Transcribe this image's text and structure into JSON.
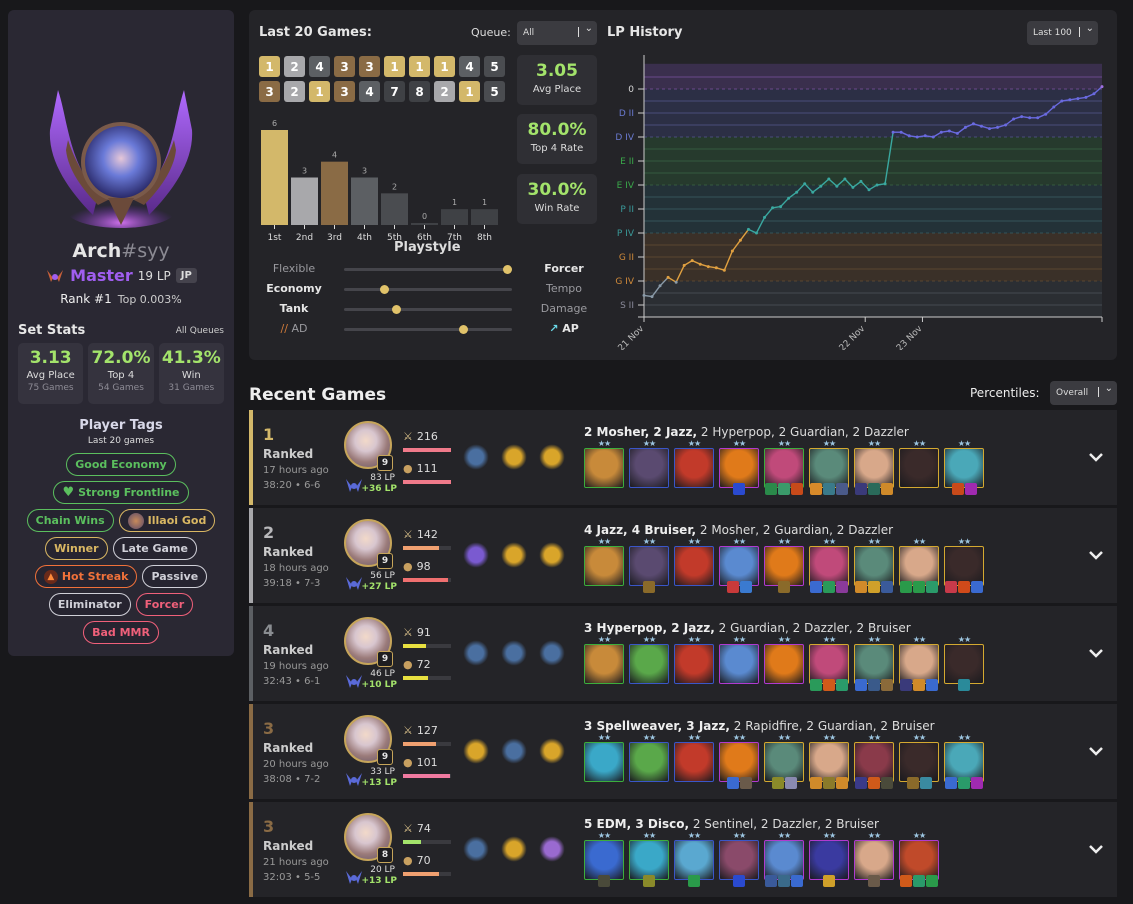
{
  "profile": {
    "name": "Arch",
    "tag": "#syy",
    "tier": "Master",
    "lp": "19 LP",
    "region": "JP",
    "rank": "Rank #1",
    "top": "Top 0.003%",
    "set_stats_title": "Set Stats",
    "set_stats_queue": "All Queues",
    "stats": [
      {
        "value": "3.13",
        "label": "Avg Place",
        "sub": "75 Games"
      },
      {
        "value": "72.0%",
        "label": "Top 4",
        "sub": "54 Games"
      },
      {
        "value": "41.3%",
        "label": "Win",
        "sub": "31 Games"
      }
    ],
    "tags_title": "Player Tags",
    "tags_subtitle": "Last 20 games",
    "tags": [
      {
        "label": "Good Economy",
        "color": "#5bbf5e",
        "icon": ""
      },
      {
        "label": "Strong Frontline",
        "color": "#5bbf5e",
        "icon": "heart-icon"
      },
      {
        "label": "Chain Wins",
        "color": "#5bbf5e",
        "icon": ""
      },
      {
        "label": "Illaoi God",
        "color": "#d9b763",
        "icon": "champion-icon"
      },
      {
        "label": "Winner",
        "color": "#d9b763",
        "icon": ""
      },
      {
        "label": "Late Game",
        "color": "#d0d0d8",
        "icon": ""
      },
      {
        "label": "Hot Streak",
        "color": "#f0713a",
        "icon": "fire-icon"
      },
      {
        "label": "Passive",
        "color": "#d0d0d8",
        "icon": ""
      },
      {
        "label": "Eliminator",
        "color": "#d0d0d8",
        "icon": ""
      },
      {
        "label": "Forcer",
        "color": "#f0607a",
        "icon": ""
      },
      {
        "label": "Bad MMR",
        "color": "#f0607a",
        "icon": ""
      }
    ]
  },
  "last20": {
    "title": "Last 20 Games:",
    "queue_label": "Queue:",
    "queue_value": "All",
    "placements": [
      1,
      2,
      4,
      3,
      3,
      1,
      1,
      1,
      4,
      5,
      3,
      2,
      1,
      3,
      4,
      7,
      8,
      2,
      1,
      5
    ],
    "avg_place": {
      "value": "3.05",
      "label": "Avg Place"
    },
    "top4_rate": {
      "value": "80.0%",
      "label": "Top 4 Rate"
    },
    "win_rate": {
      "value": "30.0%",
      "label": "Win Rate"
    },
    "place_colors": {
      "1": "#d3b86a",
      "2": "#a8a8ab",
      "3": "#8a6b45",
      "4": "#5c5f63",
      "5": "#4a4c50",
      "6": "#3f4145",
      "7": "#3f4145",
      "8": "#3f4145"
    }
  },
  "chart_data": [
    {
      "type": "bar",
      "title": "Placement distribution",
      "categories": [
        "1st",
        "2nd",
        "3rd",
        "4th",
        "5th",
        "6th",
        "7th",
        "8th"
      ],
      "values": [
        6,
        3,
        4,
        3,
        2,
        0,
        1,
        1
      ],
      "ylim": [
        0,
        6
      ]
    },
    {
      "type": "line",
      "title": "LP History",
      "range_label": "Last 100",
      "y_tick_labels": [
        "0",
        "D II",
        "D IV",
        "E II",
        "E IV",
        "P II",
        "P IV",
        "G II",
        "G IV",
        "S II"
      ],
      "x_tick_labels": [
        "21 Nov",
        "22 Nov",
        "23 Nov"
      ],
      "y_units": "ladder steps (0 = Master 0 LP, each tick = 1 division step, S II = 9)",
      "values": [
        8.6,
        8.65,
        8.2,
        7.85,
        8.05,
        7.35,
        7.15,
        7.3,
        7.4,
        7.45,
        7.55,
        6.75,
        6.3,
        5.85,
        6.0,
        5.35,
        4.95,
        4.9,
        4.55,
        4.3,
        3.95,
        4.3,
        4.05,
        3.75,
        4.05,
        3.75,
        4.1,
        3.85,
        4.2,
        4.0,
        3.95,
        1.8,
        1.8,
        1.95,
        2.0,
        1.95,
        2.0,
        1.8,
        1.75,
        1.85,
        1.6,
        1.45,
        1.55,
        1.65,
        1.6,
        1.5,
        1.25,
        1.15,
        1.2,
        1.2,
        1.05,
        0.75,
        0.5,
        0.45,
        0.4,
        0.35,
        0.2,
        -0.1
      ],
      "bands": [
        {
          "name": "Master",
          "color": "#3a2f4d"
        },
        {
          "name": "Diamond",
          "color": "#2c2f45"
        },
        {
          "name": "Emerald",
          "color": "#263a2d"
        },
        {
          "name": "Platinum",
          "color": "#233238"
        },
        {
          "name": "Gold",
          "color": "#3a3028"
        },
        {
          "name": "Silver",
          "color": "#2b2e33"
        }
      ]
    }
  ],
  "playstyle": {
    "title": "Playstyle",
    "rows": [
      {
        "left": "Flexible",
        "right": "Forcer",
        "value": 0.97,
        "left_bold": false,
        "right_bold": true
      },
      {
        "left": "Economy",
        "right": "Tempo",
        "value": 0.24,
        "left_bold": true,
        "right_bold": false
      },
      {
        "left": "Tank",
        "right": "Damage",
        "value": 0.31,
        "left_bold": true,
        "right_bold": false
      },
      {
        "left": "AD",
        "right": "AP",
        "value": 0.71,
        "left_bold": false,
        "right_bold": true
      }
    ]
  },
  "recent": {
    "title": "Recent Games",
    "percentiles_label": "Percentiles:",
    "percentiles_value": "Overall",
    "games": [
      {
        "place": "1",
        "queue": "Ranked",
        "ago": "17 hours ago",
        "duration": "38:20 • 6-6",
        "level": "9",
        "lp": "83 LP",
        "lp_delta": "+36 LP",
        "damage": "216",
        "damage_pct": 1.0,
        "damage_color": "#f07a8a",
        "gold": "111",
        "gold_pct": 1.0,
        "gold_color": "#f07a8a",
        "border": "#d3b86a",
        "place_color": "#d3b86a",
        "augments": [
          "#4a6fa0",
          "#d9a52a",
          "#d9a52a"
        ],
        "traits_main": "2 Mosher, 2 Jazz,",
        "traits_rest": "2 Hyperpop, 2 Guardian, 2 Dazzler",
        "units": [
          {
            "b": "#3cae3c",
            "c": "#c88a3a",
            "items": []
          },
          {
            "b": "#3a56c8",
            "c": "#5a4a70",
            "items": []
          },
          {
            "b": "#3a56c8",
            "c": "#c23a2a",
            "items": []
          },
          {
            "b": "#b03ad0",
            "c": "#e07a1a",
            "items": [
              "#2a4ad0"
            ]
          },
          {
            "b": "#3cae3c",
            "c": "#c04a7a",
            "items": [
              "#2a8a4a",
              "#3a9a6a",
              "#c84a1a"
            ]
          },
          {
            "b": "#d4a930",
            "c": "#5a8a7a",
            "items": [
              "#d88a2a",
              "#3a7a8a",
              "#4a5a8a"
            ]
          },
          {
            "b": "#d4a930",
            "c": "#d8a88a",
            "items": [
              "#3a3a7a",
              "#2a6a5a",
              "#d08a2a"
            ]
          },
          {
            "b": "#d4a930",
            "c": "#3a2a2a",
            "items": []
          },
          {
            "b": "#d4a930",
            "c": "#4aa8b8",
            "items": [
              "#c84a1a",
              "#a02ab0"
            ]
          }
        ]
      },
      {
        "place": "2",
        "queue": "Ranked",
        "ago": "18 hours ago",
        "duration": "39:18 • 7-3",
        "level": "9",
        "lp": "56 LP",
        "lp_delta": "+27 LP",
        "damage": "142",
        "damage_pct": 0.75,
        "damage_color": "#f0a070",
        "gold": "98",
        "gold_pct": 0.93,
        "gold_color": "#f07070",
        "border": "#a8a8ab",
        "place_color": "#b8b8bb",
        "augments": [
          "#7a5ad0",
          "#d9a52a",
          "#d9a52a"
        ],
        "traits_main": "4 Jazz, 4 Bruiser,",
        "traits_rest": "2 Mosher, 2 Guardian, 2 Dazzler",
        "units": [
          {
            "b": "#3cae3c",
            "c": "#c88a3a",
            "items": []
          },
          {
            "b": "#3a56c8",
            "c": "#5a4a70",
            "items": [
              "#8a6a2a"
            ]
          },
          {
            "b": "#3a56c8",
            "c": "#c23a2a",
            "items": []
          },
          {
            "b": "#b03ad0",
            "c": "#5a8ad0",
            "items": [
              "#c83a3a",
              "#3a7ad0"
            ]
          },
          {
            "b": "#b03ad0",
            "c": "#e07a1a",
            "items": [
              "#8a6a2a"
            ]
          },
          {
            "b": "#d4a930",
            "c": "#c04a7a",
            "items": [
              "#3a6ad0",
              "#2a9a5a",
              "#8a3a9a"
            ]
          },
          {
            "b": "#d4a930",
            "c": "#5a8a7a",
            "items": [
              "#d08a2a",
              "#d0a02a",
              "#3a5a9a"
            ]
          },
          {
            "b": "#d4a930",
            "c": "#d8a88a",
            "items": [
              "#2a9a4a",
              "#2a9a4a",
              "#2a9a6a"
            ]
          },
          {
            "b": "#d4a930",
            "c": "#3a2a2a",
            "items": [
              "#c83a4a",
              "#d04a1a",
              "#3a6ad0"
            ]
          }
        ]
      },
      {
        "place": "4",
        "queue": "Ranked",
        "ago": "19 hours ago",
        "duration": "32:43 • 6-1",
        "level": "9",
        "lp": "46 LP",
        "lp_delta": "+10 LP",
        "damage": "91",
        "damage_pct": 0.48,
        "damage_color": "#e8e040",
        "gold": "72",
        "gold_pct": 0.52,
        "gold_color": "#e8e040",
        "border": "#5c5f63",
        "place_color": "#8a8d91",
        "augments": [
          "#4a6fa0",
          "#4a6fa0",
          "#4a6fa0"
        ],
        "traits_main": "3 Hyperpop, 2 Jazz,",
        "traits_rest": "2 Guardian, 2 Dazzler, 2 Bruiser",
        "units": [
          {
            "b": "#3cae3c",
            "c": "#c88a3a",
            "items": []
          },
          {
            "b": "#3a56c8",
            "c": "#5aa84a",
            "items": []
          },
          {
            "b": "#3a56c8",
            "c": "#c23a2a",
            "items": []
          },
          {
            "b": "#b03ad0",
            "c": "#5a8ad0",
            "items": []
          },
          {
            "b": "#b03ad0",
            "c": "#e07a1a",
            "items": []
          },
          {
            "b": "#d4a930",
            "c": "#c04a7a",
            "items": [
              "#2a9a5a",
              "#d05a1a",
              "#2a9a6a"
            ]
          },
          {
            "b": "#d4a930",
            "c": "#5a8a7a",
            "items": [
              "#3a6ad0",
              "#3a5a8a",
              "#8a6a3a"
            ]
          },
          {
            "b": "#d4a930",
            "c": "#d8a88a",
            "items": [
              "#3a3a7a",
              "#d08a2a",
              "#3a6ad0"
            ]
          },
          {
            "b": "#d4a930",
            "c": "#3a2a2a",
            "items": [
              "#2a8a9a"
            ]
          }
        ]
      },
      {
        "place": "3",
        "queue": "Ranked",
        "ago": "20 hours ago",
        "duration": "38:08 • 7-2",
        "level": "9",
        "lp": "33 LP",
        "lp_delta": "+13 LP",
        "damage": "127",
        "damage_pct": 0.68,
        "damage_color": "#f0a070",
        "gold": "101",
        "gold_pct": 0.98,
        "gold_color": "#f07aa0",
        "border": "#8a6b45",
        "place_color": "#8a6b45",
        "augments": [
          "#d9a52a",
          "#4a6fa0",
          "#d9a52a"
        ],
        "traits_main": "3 Spellweaver, 3 Jazz,",
        "traits_rest": "2 Rapidfire, 2 Guardian, 2 Bruiser",
        "units": [
          {
            "b": "#3cae3c",
            "c": "#3aa8c8",
            "items": []
          },
          {
            "b": "#3a56c8",
            "c": "#5aa84a",
            "items": []
          },
          {
            "b": "#3a56c8",
            "c": "#c23a2a",
            "items": []
          },
          {
            "b": "#b03ad0",
            "c": "#e07a1a",
            "items": [
              "#3a6ad0",
              "#6a5a4a"
            ]
          },
          {
            "b": "#d4a930",
            "c": "#5a8a7a",
            "items": [
              "#8a8a2a",
              "#8a8ab0"
            ]
          },
          {
            "b": "#d4a930",
            "c": "#d8a88a",
            "items": [
              "#d08a2a",
              "#8a7a2a",
              "#d08a2a"
            ]
          },
          {
            "b": "#d4a930",
            "c": "#8a3a4a",
            "items": [
              "#3a3a8a",
              "#d05a1a",
              "#4a4a3a"
            ]
          },
          {
            "b": "#d4a930",
            "c": "#3a2a2a",
            "items": [
              "#8a6a2a",
              "#3a8aa0"
            ]
          },
          {
            "b": "#d4a930",
            "c": "#4aa8b8",
            "items": [
              "#3a6ad0",
              "#2a9a6a",
              "#a02ab0"
            ]
          }
        ]
      },
      {
        "place": "3",
        "queue": "Ranked",
        "ago": "21 hours ago",
        "duration": "32:03 • 5-5",
        "level": "8",
        "lp": "20 LP",
        "lp_delta": "+13 LP",
        "damage": "74",
        "damage_pct": 0.38,
        "damage_color": "#a3e36b",
        "gold": "70",
        "gold_pct": 0.75,
        "gold_color": "#f0a070",
        "border": "#8a6b45",
        "place_color": "#8a6b45",
        "augments": [
          "#4a6fa0",
          "#d9a52a",
          "#9a6ad0"
        ],
        "traits_main": "5 EDM, 3 Disco,",
        "traits_rest": "2 Sentinel, 2 Dazzler, 2 Bruiser",
        "units": [
          {
            "b": "#3cae3c",
            "c": "#3a6ad0",
            "items": [
              "#4a4a3a"
            ]
          },
          {
            "b": "#3cae3c",
            "c": "#3aa8c8",
            "items": [
              "#8a8a2a"
            ]
          },
          {
            "b": "#3a56c8",
            "c": "#5aa8d0",
            "items": [
              "#2a9a4a"
            ]
          },
          {
            "b": "#3a56c8",
            "c": "#8a4a6a",
            "items": [
              "#2a4ad0"
            ]
          },
          {
            "b": "#b03ad0",
            "c": "#5a8ad0",
            "items": [
              "#3a5a9a",
              "#3a6a8a",
              "#3a6ad0"
            ]
          },
          {
            "b": "#b03ad0",
            "c": "#3a3aa0",
            "items": [
              "#d0a02a"
            ]
          },
          {
            "b": "#b03ad0",
            "c": "#d8a88a",
            "items": [
              "#6a5a4a"
            ]
          },
          {
            "b": "#b03ad0",
            "c": "#c04a2a",
            "items": [
              "#d05a1a",
              "#2a9a6a",
              "#2a9a4a"
            ]
          }
        ]
      }
    ]
  }
}
